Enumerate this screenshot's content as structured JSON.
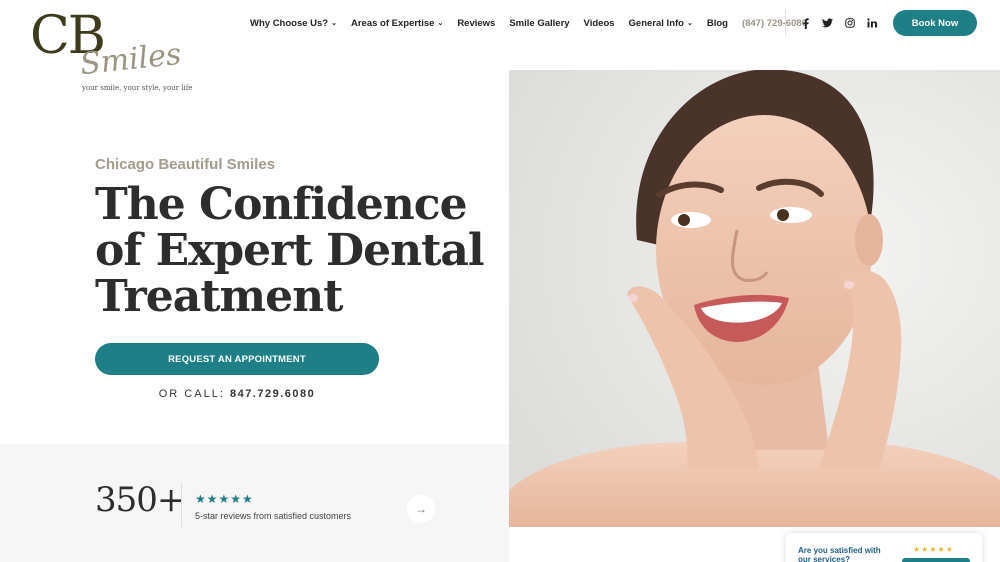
{
  "brand": {
    "logo_initials": "CB",
    "logo_script": "Smiles",
    "tagline": "your smile, your style, your life"
  },
  "nav": {
    "items": [
      {
        "label": "Why Choose Us?",
        "dropdown": true
      },
      {
        "label": "Areas of Expertise",
        "dropdown": true
      },
      {
        "label": "Reviews",
        "dropdown": false
      },
      {
        "label": "Smile Gallery",
        "dropdown": false
      },
      {
        "label": "Videos",
        "dropdown": false
      },
      {
        "label": "General Info",
        "dropdown": true
      },
      {
        "label": "Blog",
        "dropdown": false
      }
    ],
    "phone": "(847) 729-6080",
    "social": [
      "facebook-icon",
      "twitter-icon",
      "instagram-icon",
      "linkedin-icon"
    ],
    "book_label": "Book Now"
  },
  "hero": {
    "eyebrow": "Chicago Beautiful Smiles",
    "headline_line1": "The Confidence",
    "headline_line2": "of Expert Dental",
    "headline_line3": "Treatment",
    "cta_label": "REQUEST AN APPOINTMENT",
    "call_prefix": "OR CALL:",
    "call_number": "847.729.6080"
  },
  "stats": {
    "count": "350+",
    "stars": "★★★★★",
    "caption": "5-star reviews from satisfied customers",
    "arrow": "→"
  },
  "widget": {
    "question": "Are you satisfied with our services?",
    "stars": "★★★★★"
  },
  "colors": {
    "accent": "#1e7f86",
    "eyebrow": "#a49c8c",
    "logo": "#3d3b1c"
  }
}
